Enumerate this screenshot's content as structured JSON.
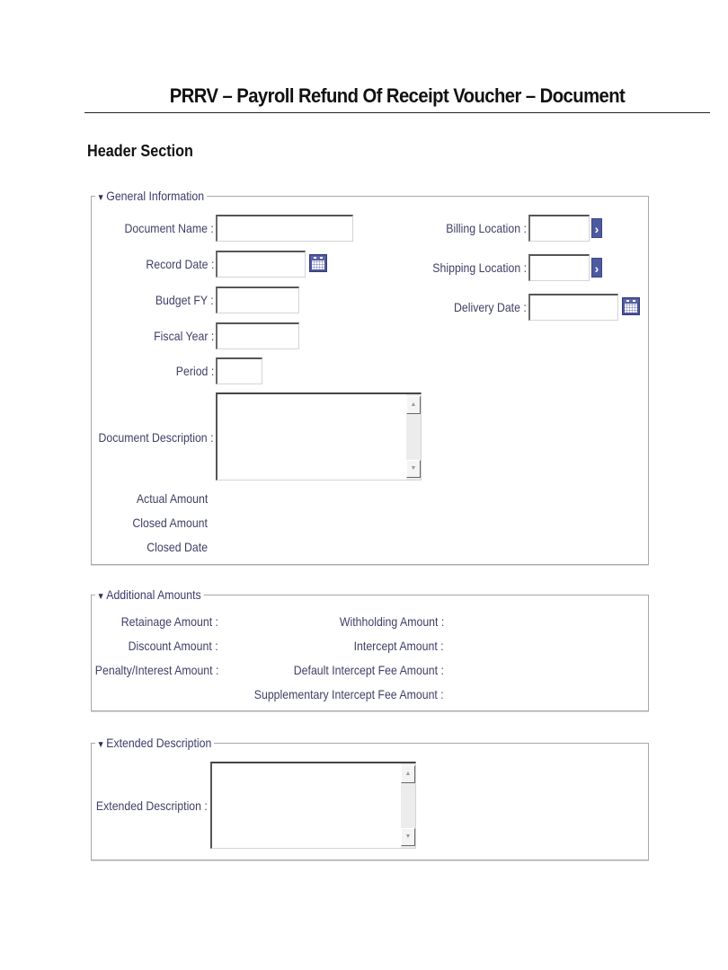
{
  "page": {
    "title": "PRRV – Payroll Refund Of Receipt Voucher – Document",
    "section_heading": "Header Section"
  },
  "general_information": {
    "legend": "General Information",
    "toggle_icon": "triangle-down-icon",
    "fields": {
      "document_name": {
        "label": "Document Name :",
        "value": ""
      },
      "record_date": {
        "label": "Record Date :",
        "value": "",
        "icon": "calendar-icon"
      },
      "budget_fy": {
        "label": "Budget FY :",
        "value": ""
      },
      "fiscal_year": {
        "label": "Fiscal Year :",
        "value": ""
      },
      "period": {
        "label": "Period :",
        "value": ""
      },
      "document_description": {
        "label": "Document Description :",
        "value": ""
      },
      "billing_location": {
        "label": "Billing Location :",
        "value": "",
        "icon": "chevron-right-icon"
      },
      "shipping_location": {
        "label": "Shipping Location :",
        "value": "",
        "icon": "chevron-right-icon"
      },
      "delivery_date": {
        "label": "Delivery Date :",
        "value": "",
        "icon": "calendar-icon"
      }
    },
    "readonly": {
      "actual_amount": "Actual Amount",
      "closed_amount": "Closed Amount",
      "closed_date": "Closed Date"
    }
  },
  "additional_amounts": {
    "legend": "Additional Amounts",
    "left": {
      "retainage": "Retainage Amount :",
      "discount": "Discount Amount :",
      "penalty_interest": "Penalty/Interest Amount :"
    },
    "right": {
      "withholding": "Withholding Amount :",
      "intercept": "Intercept Amount :",
      "default_intercept_fee": "Default Intercept Fee Amount :",
      "supplementary_intercept_fee": "Supplementary Intercept Fee Amount :"
    }
  },
  "extended_description": {
    "legend": "Extended Description",
    "field": {
      "label": "Extended Description :",
      "value": ""
    }
  },
  "colors": {
    "icon_blue": "#4e5aa0",
    "label_text": "#3f3f66",
    "border": "#a8a8a8"
  }
}
